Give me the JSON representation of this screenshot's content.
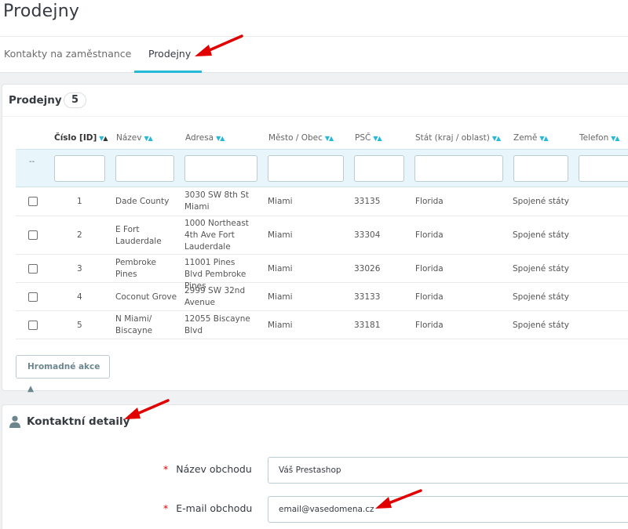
{
  "page": {
    "title": "Prodejny"
  },
  "tabs": [
    {
      "label": "Kontakty na zaměstnance",
      "active": false
    },
    {
      "label": "Prodejny",
      "active": true
    }
  ],
  "stores_panel": {
    "title": "Prodejny",
    "count": "5",
    "headers": [
      {
        "label": "Číslo [ID]",
        "sort": "▼▲"
      },
      {
        "label": "Název",
        "sort": "▼▲"
      },
      {
        "label": "Adresa",
        "sort": "▼▲"
      },
      {
        "label": "Město / Obec",
        "sort": "▼▲"
      },
      {
        "label": "PSČ",
        "sort": "▼▲"
      },
      {
        "label": "Stát (kraj / oblast)",
        "sort": "▼▲"
      },
      {
        "label": "Země",
        "sort": "▼▲"
      },
      {
        "label": "Telefon",
        "sort": "▼▲"
      }
    ],
    "filter_dots": "--",
    "rows": [
      {
        "id": "1",
        "name": "Dade County",
        "address": "3030 SW 8th St Miami",
        "city": "Miami",
        "zip": "33135",
        "state": "Florida",
        "country": "Spojené státy"
      },
      {
        "id": "2",
        "name": "E Fort Lauderdale",
        "address": "1000 Northeast 4th Ave Fort Lauderdale",
        "city": "Miami",
        "zip": "33304",
        "state": "Florida",
        "country": "Spojené státy"
      },
      {
        "id": "3",
        "name": "Pembroke Pines",
        "address": "11001 Pines Blvd Pembroke Pines",
        "city": "Miami",
        "zip": "33026",
        "state": "Florida",
        "country": "Spojené státy"
      },
      {
        "id": "4",
        "name": "Coconut Grove",
        "address": "2999 SW 32nd Avenue",
        "city": "Miami",
        "zip": "33133",
        "state": "Florida",
        "country": "Spojené státy"
      },
      {
        "id": "5",
        "name": "N Miami/ Biscayne",
        "address": "12055 Biscayne Blvd",
        "city": "Miami",
        "zip": "33181",
        "state": "Florida",
        "country": "Spojené státy"
      }
    ],
    "bulk_actions_label": "Hromadné akce ▲"
  },
  "contact_panel": {
    "title": "Kontaktní detaily",
    "icon": "user-icon",
    "required_marker": "*",
    "fields": [
      {
        "label": "Název obchodu",
        "value": "Váš Prestashop"
      },
      {
        "label": "E-mail obchodu",
        "value": "email@vasedomena.cz"
      }
    ]
  },
  "colors": {
    "accent": "#25b9d7",
    "annotation_arrow": "#e00000",
    "required": "#e30000"
  }
}
